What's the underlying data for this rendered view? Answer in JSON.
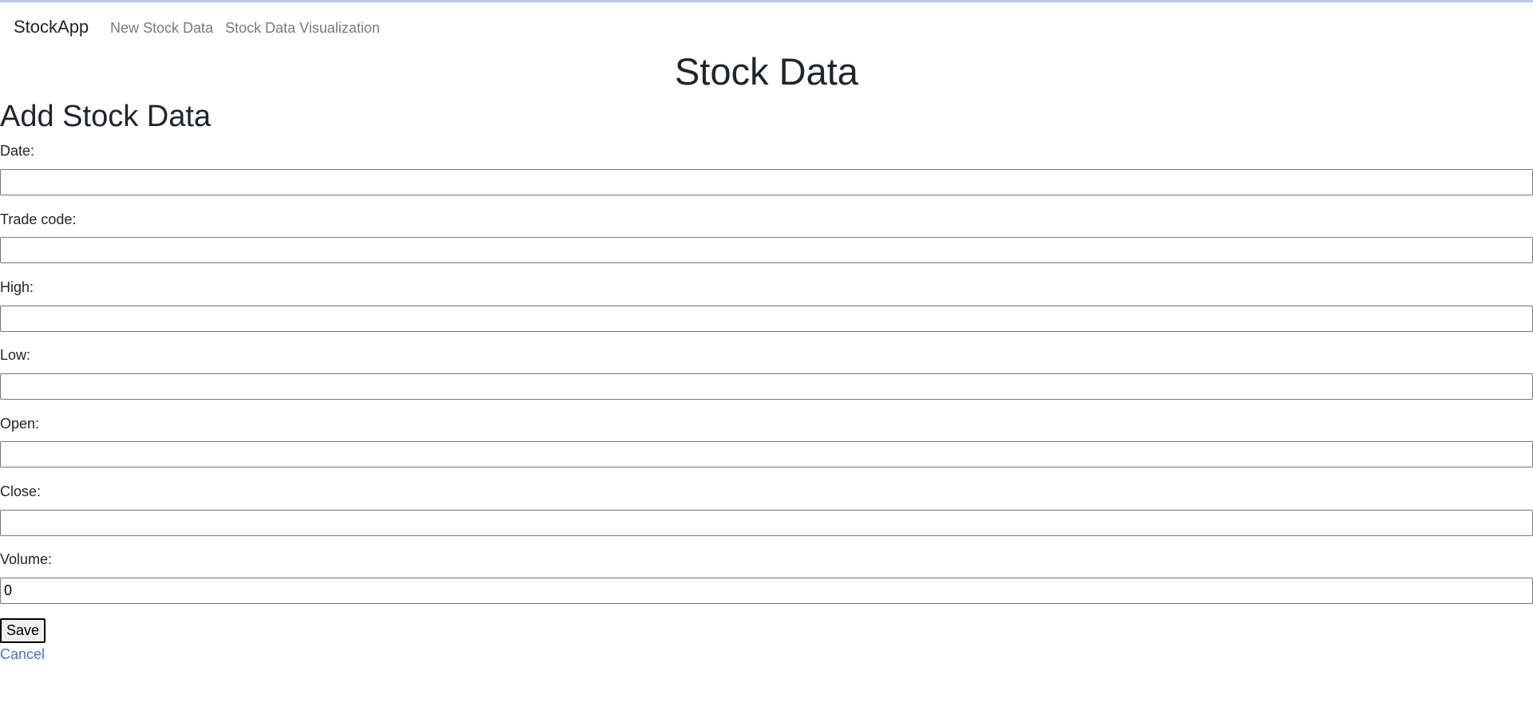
{
  "navbar": {
    "brand": "StockApp",
    "links": [
      "New Stock Data",
      "Stock Data Visualization"
    ]
  },
  "page": {
    "title": "Stock Data",
    "section_title": "Add Stock Data"
  },
  "form": {
    "fields": [
      {
        "label": "Date:",
        "value": ""
      },
      {
        "label": "Trade code:",
        "value": ""
      },
      {
        "label": "High:",
        "value": ""
      },
      {
        "label": "Low:",
        "value": ""
      },
      {
        "label": "Open:",
        "value": ""
      },
      {
        "label": "Close:",
        "value": ""
      },
      {
        "label": "Volume:",
        "value": "0"
      }
    ],
    "save_label": "Save",
    "cancel_label": "Cancel"
  },
  "colors": {
    "top_accent": "#b9c6ee",
    "link": "#4a6ee0",
    "nav_link": "#7a7a7a"
  }
}
